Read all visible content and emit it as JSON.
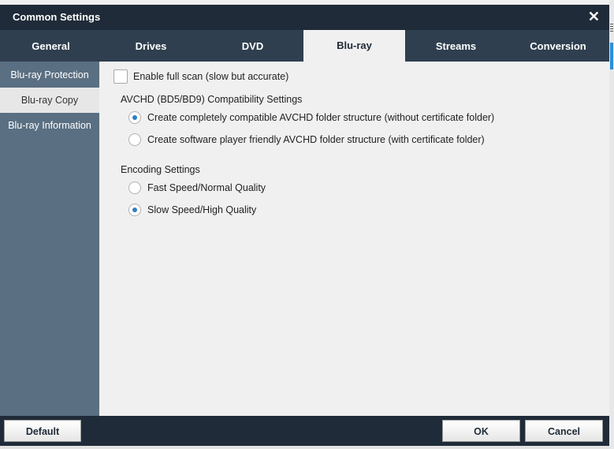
{
  "window": {
    "title": "Common Settings",
    "close_glyph": "✕"
  },
  "tabs": [
    {
      "label": "General"
    },
    {
      "label": "Drives"
    },
    {
      "label": "DVD"
    },
    {
      "label": "Blu-ray",
      "active": true
    },
    {
      "label": "Streams"
    },
    {
      "label": "Conversion"
    }
  ],
  "sidebar": {
    "items": [
      {
        "label": "Blu-ray Protection"
      },
      {
        "label": "Blu-ray Copy",
        "active": true
      },
      {
        "label": "Blu-ray Information"
      }
    ]
  },
  "content": {
    "full_scan": {
      "label": "Enable full scan (slow but accurate)",
      "checked": false
    },
    "avchd": {
      "heading": "AVCHD (BD5/BD9) Compatibility Settings",
      "options": [
        {
          "label": "Create completely compatible AVCHD folder structure (without certificate folder)",
          "checked": true
        },
        {
          "label": "Create software player friendly AVCHD folder structure (with certificate folder)",
          "checked": false
        }
      ]
    },
    "encoding": {
      "heading": "Encoding Settings",
      "options": [
        {
          "label": "Fast Speed/Normal Quality",
          "checked": false
        },
        {
          "label": "Slow Speed/High Quality",
          "checked": true
        }
      ]
    }
  },
  "footer": {
    "default_label": "Default",
    "ok_label": "OK",
    "cancel_label": "Cancel"
  },
  "colors": {
    "titlebar": "#1f2b38",
    "tabbar": "#2f3f4f",
    "sidebar": "#5a6f82",
    "content_bg": "#f0f0f0",
    "radio_dot": "#2f7fc1"
  }
}
